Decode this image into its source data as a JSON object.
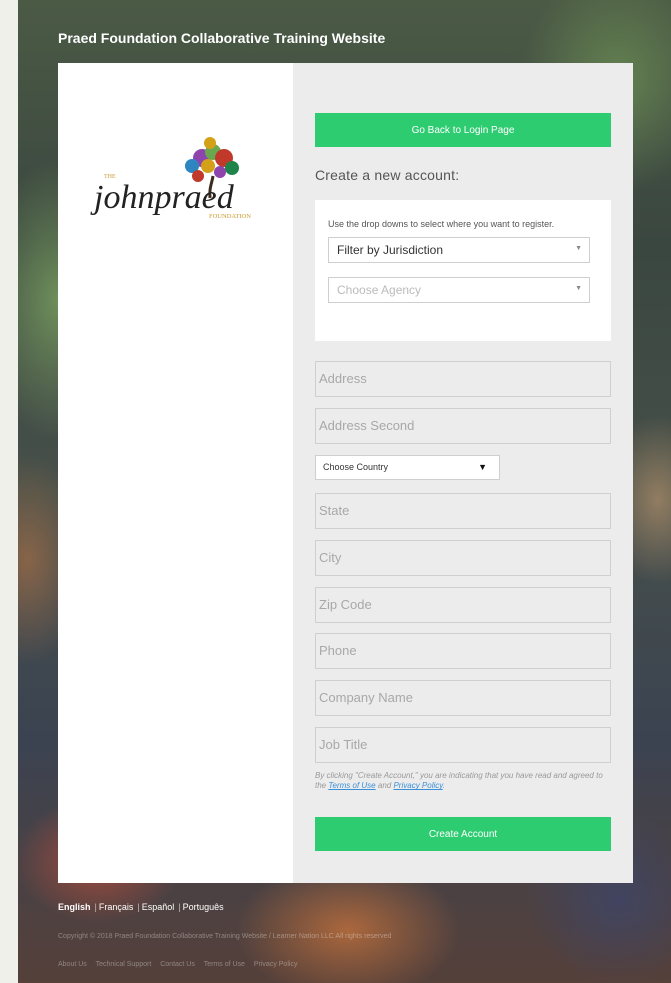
{
  "header": {
    "site_title": "Praed Foundation Collaborative Training Website"
  },
  "logo": {
    "small_text": "THE",
    "wordmark": "johnpraed",
    "sub_text": "FOUNDATION"
  },
  "form": {
    "back_button": "Go Back to Login Page",
    "heading": "Create a new account:",
    "registration": {
      "hint": "Use the drop downs to select where you want to register.",
      "jurisdiction_select": "Filter by Jurisdiction",
      "agency_select": "Choose Agency"
    },
    "fields": {
      "address": "Address",
      "address_second": "Address Second",
      "country_select": "Choose Country",
      "state": "State",
      "city": "City",
      "zip": "Zip Code",
      "phone": "Phone",
      "company": "Company Name",
      "job_title": "Job Title"
    },
    "legal": {
      "prefix": "By clicking \"Create Account,\" you are indicating that you have read and agreed to the",
      "terms_link": "Terms of Use",
      "and": "and",
      "privacy_link": "Privacy Policy",
      "suffix": "."
    },
    "submit_button": "Create Account"
  },
  "footer": {
    "languages": [
      "English",
      "Français",
      "Español",
      "Português"
    ],
    "copyright": "Copyright © 2018 Praed Foundation Collaborative Training Website / Learner Nation LLC All rights reserved",
    "links": [
      "About Us",
      "Technical Support",
      "Contact Us",
      "Terms of Use",
      "Privacy Policy"
    ]
  },
  "colors": {
    "accent_green": "#2ecc71",
    "link_blue": "#3b8fd8",
    "logo_gold": "#c99a2e"
  }
}
